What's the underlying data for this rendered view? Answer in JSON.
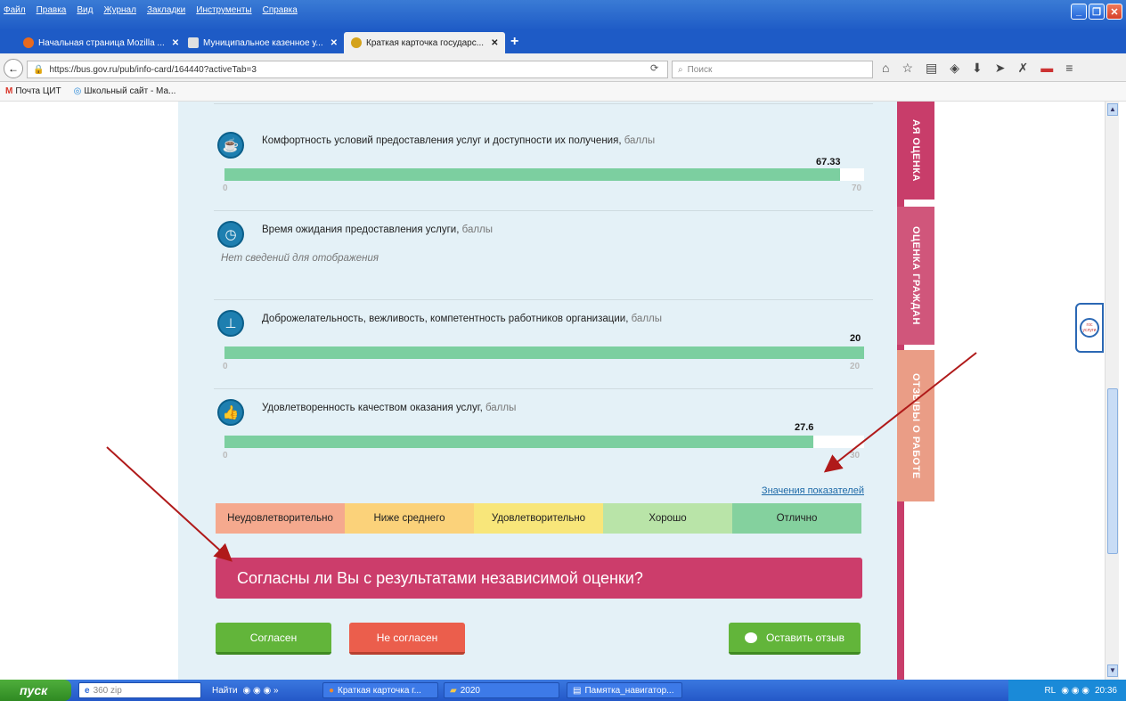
{
  "menu": [
    "Файл",
    "Правка",
    "Вид",
    "Журнал",
    "Закладки",
    "Инструменты",
    "Справка"
  ],
  "tabs": [
    {
      "label": "Начальная страница Mozilla ...",
      "active": false
    },
    {
      "label": "Муниципальное казенное у...",
      "active": false
    },
    {
      "label": "Краткая карточка государс...",
      "active": true
    }
  ],
  "address": {
    "url": "https://bus.gov.ru/pub/info-card/164440?activeTab=3",
    "search_placeholder": "Поиск"
  },
  "bookmarks": [
    "Почта ЦИТ",
    "Школьный сайт - Ма..."
  ],
  "unit_label": "баллы",
  "metrics": [
    {
      "label": "Комфортность условий предоставления услуг и доступности их получения",
      "value": "67.33",
      "fraction": 0.962,
      "min": "0",
      "max": "70",
      "icon": "cup-icon"
    },
    {
      "label": "Время ожидания предоставления услуги",
      "nodata": "Нет сведений для отображения",
      "icon": "clock-icon"
    },
    {
      "label": "Доброжелательность, вежливость, компетентность работников организации",
      "value": "20",
      "fraction": 1.0,
      "min": "0",
      "max": "20",
      "icon": "tie-icon"
    },
    {
      "label": "Удовлетворенность качеством оказания услуг",
      "value": "27.6",
      "fraction": 0.92,
      "min": "0",
      "max": "30",
      "icon": "thumbs-up-icon"
    }
  ],
  "legend_link": "Значения показателей",
  "scale": [
    {
      "label": "Неудовлетворительно",
      "color": "#f5a98e"
    },
    {
      "label": "Ниже среднего",
      "color": "#fbd27a"
    },
    {
      "label": "Удовлетворительно",
      "color": "#f8e67a"
    },
    {
      "label": "Хорошо",
      "color": "#b9e4a8"
    },
    {
      "label": "Отлично",
      "color": "#84d19e"
    }
  ],
  "question": "Согласны ли Вы с результатами независимой оценки?",
  "buttons": {
    "agree": "Согласен",
    "disagree": "Не согласен",
    "review": "Оставить отзыв"
  },
  "side_tabs": [
    "АЯ ОЦЕНКА",
    "ОЦЕНКА ГРАЖДАН",
    "ОТЗЫВЫ О РАБОТЕ"
  ],
  "gos_label": "гос услуги",
  "taskbar": {
    "start": "пуск",
    "items": [
      "360 zip",
      "Найти",
      "Краткая карточка г...",
      "2020",
      "Памятка_навигатор..."
    ],
    "lang": "RL",
    "time": "20:36"
  }
}
